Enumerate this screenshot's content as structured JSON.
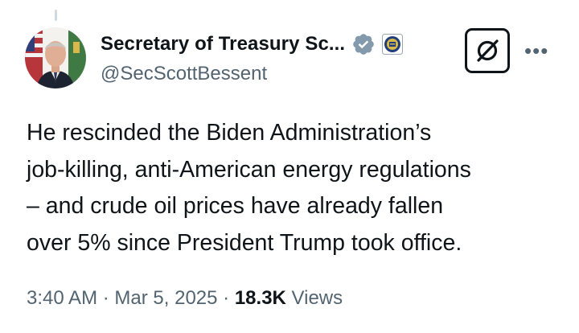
{
  "author": {
    "display_name": "Secretary of Treasury Sc...",
    "handle": "@SecScottBessent",
    "verified_badge_icon": "verified-badge-icon",
    "affiliate_badge_icon": "treasury-seal-icon"
  },
  "actions": {
    "grok_icon": "grok-icon",
    "more_icon": "more-options-icon",
    "more_label": "•••"
  },
  "tweet": {
    "lines": [
      "He rescinded the Biden Administration’s",
      "job-killing, anti-American energy regulations",
      "– and crude oil prices have already fallen",
      "over 5% since President Trump took office."
    ]
  },
  "meta": {
    "time": "3:40 AM",
    "separator": "·",
    "date": "Mar 5, 2025",
    "views_count": "18.3K",
    "views_label": "Views"
  },
  "colors": {
    "text": "#0f1419",
    "secondary": "#536471",
    "verified": "#829aab"
  }
}
